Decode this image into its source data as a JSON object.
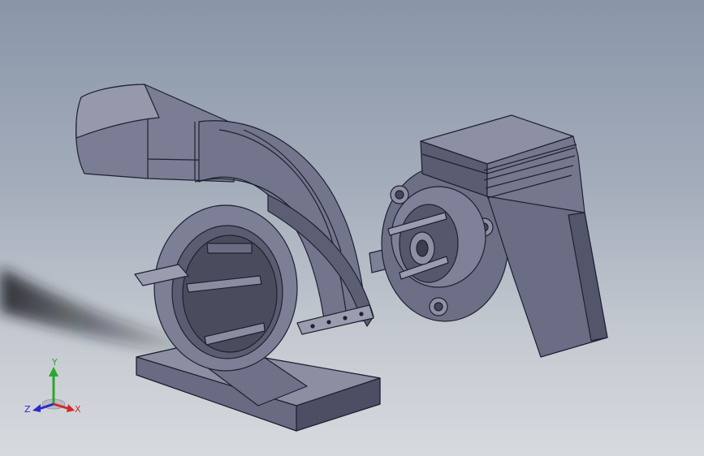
{
  "view": {
    "model_parts": [
      "blower-housing",
      "outlet-duct",
      "shaft",
      "bearing-flange",
      "motor-housing",
      "pump-base"
    ],
    "background_colors": [
      "#8996a9",
      "#a3acba",
      "#c3c8d0",
      "#d7dade"
    ],
    "model_color": "#6e7188"
  },
  "triad": {
    "x_label": "X",
    "y_label": "Y",
    "z_label": "Z",
    "x_color": "#d02a2a",
    "y_color": "#2aa82a",
    "z_color": "#2a2ad0"
  }
}
